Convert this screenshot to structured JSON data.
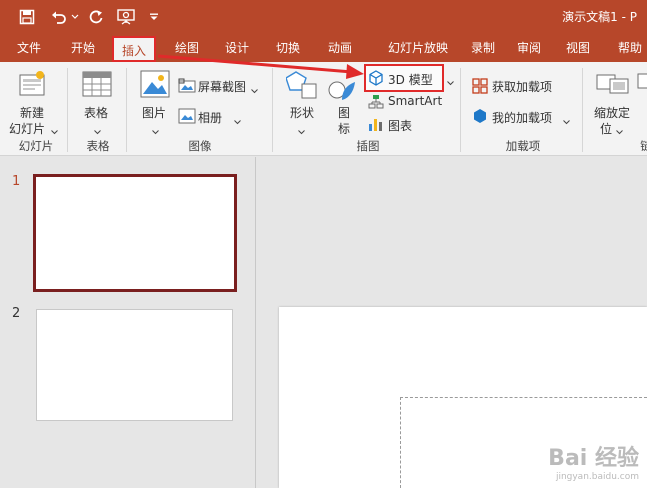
{
  "titlebar": {
    "doc_title": "演示文稿1 - P"
  },
  "tabs": [
    {
      "label": "文件"
    },
    {
      "label": "开始"
    },
    {
      "label": "插入"
    },
    {
      "label": "绘图"
    },
    {
      "label": "设计"
    },
    {
      "label": "切换"
    },
    {
      "label": "动画"
    },
    {
      "label": "幻灯片放映"
    },
    {
      "label": "录制"
    },
    {
      "label": "审阅"
    },
    {
      "label": "视图"
    },
    {
      "label": "帮助"
    }
  ],
  "ribbon": {
    "new_slide": "新建",
    "new_slide_2": "幻灯片",
    "table": "表格",
    "picture": "图片",
    "screenshot": "屏幕截图",
    "album": "相册",
    "shapes": "形状",
    "icons": "图",
    "icons_2": "标",
    "model3d": "3D 模型",
    "smartart": "SmartArt",
    "chart": "图表",
    "get_addins": "获取加载项",
    "my_addins": "我的加载项",
    "zoom": "缩放定",
    "zoom_2": "位",
    "link_partial": "链",
    "groups": {
      "slides": "幻灯片",
      "tables": "表格",
      "images": "图像",
      "illustrations": "插图",
      "addins": "加载项"
    }
  },
  "slides": [
    {
      "num": "1"
    },
    {
      "num": "2"
    }
  ],
  "watermark": {
    "brand": "Bai 经验",
    "url": "jingyan.baidu.com"
  },
  "colors": {
    "accent": "#b7472a",
    "highlight": "#e02a2a"
  }
}
